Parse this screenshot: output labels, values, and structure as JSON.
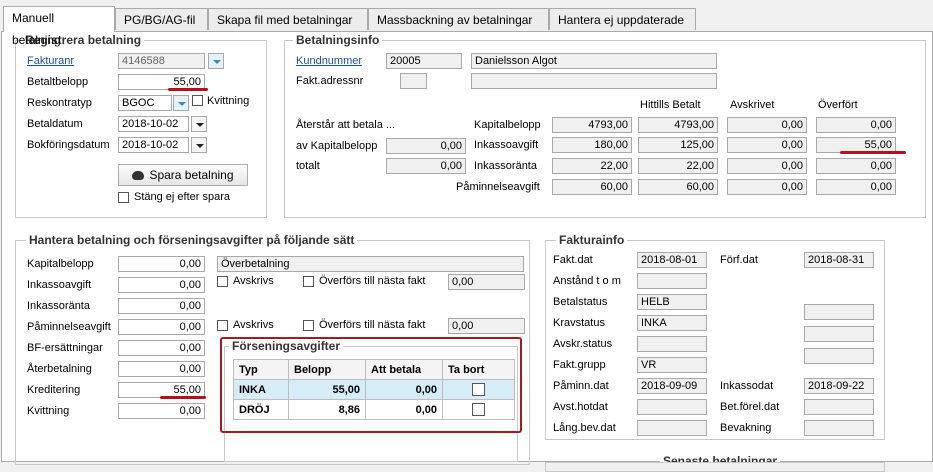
{
  "tabs": [
    "Manuell betalning",
    "PG/BG/AG-fil",
    "Skapa fil med betalningar",
    "Massbackning av betalningar",
    "Hantera ej uppdaterade"
  ],
  "registrera": {
    "title": "Registrera betalning",
    "fakturanr_label": "Fakturanr",
    "fakturanr": "4146588",
    "betaltbelopp_label": "Betaltbelopp",
    "betaltbelopp": "55,00",
    "reskontratyp_label": "Reskontratyp",
    "reskontratyp": "BGOC",
    "kvittning_label": "Kvittning",
    "betaldatum_label": "Betaldatum",
    "betaldatum": "2018-10-02",
    "bokforingsdatum_label": "Bokföringsdatum",
    "bokforingsdatum": "2018-10-02",
    "spara_label": "Spara betalning",
    "stang_label": "Stäng ej efter spara"
  },
  "betalningsinfo": {
    "title": "Betalningsinfo",
    "kundnummer_label": "Kundnummer",
    "kundnummer": "20005",
    "kundnamn": "Danielsson Algot",
    "faktadress_label": "Fakt.adressnr",
    "col_hittills": "Hittills Betalt",
    "col_avskrivet": "Avskrivet",
    "col_overfort": "Överfört",
    "aterstar_label": "Återstår att betala ...",
    "av_kapitalbelopp_label": "av Kapitalbelopp",
    "av_kapitalbelopp": "0,00",
    "totalt_label": "totalt",
    "totalt": "0,00",
    "rows": [
      {
        "label": "Kapitalbelopp",
        "belopp": "4793,00",
        "hittills": "4793,00",
        "avskrivet": "0,00",
        "overfort": "0,00"
      },
      {
        "label": "Inkassoavgift",
        "belopp": "180,00",
        "hittills": "125,00",
        "avskrivet": "0,00",
        "overfort": "55,00"
      },
      {
        "label": "Inkassoränta",
        "belopp": "22,00",
        "hittills": "22,00",
        "avskrivet": "0,00",
        "overfort": "0,00"
      },
      {
        "label": "Påminnelseavgift",
        "belopp": "60,00",
        "hittills": "60,00",
        "avskrivet": "0,00",
        "overfort": "0,00"
      }
    ]
  },
  "hantera": {
    "title": "Hantera betalning och förseningsavgifter på följande sätt",
    "rows": [
      {
        "label": "Kapitalbelopp",
        "value": "0,00"
      },
      {
        "label": "Inkassoavgift",
        "value": "0,00"
      },
      {
        "label": "Inkassoränta",
        "value": "0,00"
      },
      {
        "label": "Påminnelseavgift",
        "value": "0,00"
      },
      {
        "label": "BF-ersättningar",
        "value": "0,00"
      },
      {
        "label": "Återbetalning",
        "value": "0,00"
      },
      {
        "label": "Kreditering",
        "value": "55,00"
      },
      {
        "label": "Kvittning",
        "value": "0,00"
      }
    ],
    "overbetalning": "Överbetalning",
    "avskrivs_label": "Avskrivs",
    "overfors_label": "Överförs till nästa fakt",
    "overfors1": "0,00",
    "overfors2": "0,00"
  },
  "forsening": {
    "title": "Förseningsavgifter",
    "headers": [
      "Typ",
      "Belopp",
      "Att betala",
      "Ta bort"
    ],
    "rows": [
      {
        "typ": "INKA",
        "belopp": "55,00",
        "att_betala": "0,00"
      },
      {
        "typ": "DRÖJ",
        "belopp": "8,86",
        "att_betala": "0,00"
      }
    ]
  },
  "fakturainfo": {
    "title": "Fakturainfo",
    "faktdat_label": "Fakt.dat",
    "faktdat": "2018-08-01",
    "forfdat_label": "Förf.dat",
    "forfdat": "2018-08-31",
    "anstand_label": "Anstånd t o m",
    "betalstatus_label": "Betalstatus",
    "betalstatus": "HELB",
    "kravstatus_label": "Kravstatus",
    "kravstatus": "INKA",
    "avskrstatus_label": "Avskr.status",
    "faktgrupp_label": "Fakt.grupp",
    "faktgrupp": "VR",
    "paminndat_label": "Påminn.dat",
    "paminndat": "2018-09-09",
    "inkassodat_label": "Inkassodat",
    "inkassodat": "2018-09-22",
    "avsthotdat_label": "Avst.hotdat",
    "betforeldat_label": "Bet.förel.dat",
    "langbevdat_label": "Lång.bev.dat",
    "bevakning_label": "Bevakning"
  },
  "footer": {
    "senaste": "Senaste betalningar"
  },
  "colors": {
    "highlight": "#b2101c",
    "link": "#1f4fa0",
    "selected_row": "#d6ecf6"
  }
}
